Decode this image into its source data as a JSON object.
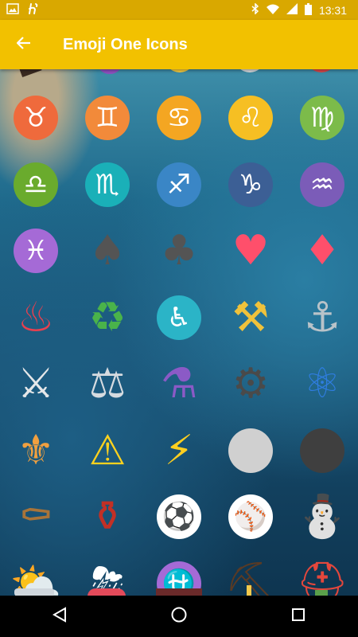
{
  "status_bar": {
    "time": "13:31",
    "left_icons": [
      "image-icon",
      "app-h-icon"
    ],
    "right_icons": [
      "bluetooth-icon",
      "wifi-icon",
      "cellular-icon",
      "battery-icon"
    ],
    "color": "#d9a800"
  },
  "app_bar": {
    "title": "Emoji One Icons",
    "back_icon": "arrow-back-icon",
    "color": "#f2c100"
  },
  "grid": {
    "rows": [
      [
        {
          "name": "taurus-icon",
          "glyph": "♉",
          "bg": "#ef6a3c"
        },
        {
          "name": "gemini-icon",
          "glyph": "♊",
          "bg": "#f28a3a"
        },
        {
          "name": "cancer-icon",
          "glyph": "♋",
          "bg": "#f4a622"
        },
        {
          "name": "leo-icon",
          "glyph": "♌",
          "bg": "#f6bf23"
        },
        {
          "name": "virgo-icon",
          "glyph": "♍",
          "bg": "#7cbb4a"
        }
      ],
      [
        {
          "name": "libra-icon",
          "glyph": "♎",
          "bg": "#6aab2d"
        },
        {
          "name": "scorpio-icon",
          "glyph": "♏",
          "bg": "#1ab0b8"
        },
        {
          "name": "sagittarius-icon",
          "glyph": "♐",
          "bg": "#3a86c6"
        },
        {
          "name": "capricorn-icon",
          "glyph": "♑",
          "bg": "#3c5f95"
        },
        {
          "name": "aquarius-icon",
          "glyph": "♒",
          "bg": "#7b5cb8"
        }
      ],
      [
        {
          "name": "pisces-icon",
          "glyph": "♓",
          "bg": "#a56ad6"
        },
        {
          "name": "spade-suit-icon",
          "glyph": "♠",
          "bg": "none",
          "color": "#545454"
        },
        {
          "name": "club-suit-icon",
          "glyph": "♣",
          "bg": "none",
          "color": "#545454"
        },
        {
          "name": "heart-suit-icon",
          "glyph": "♥",
          "bg": "none",
          "color": "#ff4f6b"
        },
        {
          "name": "diamond-suit-icon",
          "glyph": "♦",
          "bg": "none",
          "color": "#ff4f6b"
        }
      ],
      [
        {
          "name": "hot-springs-icon",
          "glyph": "♨",
          "bg": "none",
          "color": "#e8404f"
        },
        {
          "name": "recycling-icon",
          "glyph": "♻",
          "bg": "none",
          "color": "#4ab34a"
        },
        {
          "name": "wheelchair-icon",
          "glyph": "♿",
          "bg": "#2bb4c7"
        },
        {
          "name": "hammer-pick-icon",
          "glyph": "⚒",
          "bg": "none",
          "color": "#f0c23b"
        },
        {
          "name": "anchor-icon",
          "glyph": "⚓",
          "bg": "none",
          "color": "#b9c3c9"
        }
      ],
      [
        {
          "name": "crossed-swords-icon",
          "glyph": "⚔",
          "bg": "none",
          "color": "#e5e7e9"
        },
        {
          "name": "balance-scale-icon",
          "glyph": "⚖",
          "bg": "none",
          "color": "#d6dbe0"
        },
        {
          "name": "alembic-icon",
          "glyph": "⚗",
          "bg": "none",
          "color": "#8b5ac6"
        },
        {
          "name": "gear-icon",
          "glyph": "⚙",
          "bg": "none",
          "color": "#4a4a4a"
        },
        {
          "name": "atom-icon",
          "glyph": "⚛",
          "bg": "none",
          "color": "#2f7de0"
        }
      ],
      [
        {
          "name": "fleur-de-lis-icon",
          "glyph": "⚜",
          "bg": "none",
          "color": "#f0a040"
        },
        {
          "name": "warning-icon",
          "glyph": "⚠",
          "bg": "none",
          "color": "#ffd21e"
        },
        {
          "name": "high-voltage-icon",
          "glyph": "⚡",
          "bg": "none",
          "color": "#ffcf1f"
        },
        {
          "name": "white-circle-icon",
          "glyph": "",
          "bg": "#d0d0d0"
        },
        {
          "name": "black-circle-icon",
          "glyph": "",
          "bg": "#3f3f3f"
        }
      ],
      [
        {
          "name": "coffin-icon",
          "glyph": "⚰",
          "bg": "none",
          "color": "#a97439"
        },
        {
          "name": "funeral-urn-icon",
          "glyph": "⚱",
          "bg": "none",
          "color": "#c23025"
        },
        {
          "name": "soccer-ball-icon",
          "glyph": "⚽",
          "bg": "#ffffff",
          "color": "#222222"
        },
        {
          "name": "baseball-icon",
          "glyph": "⚾",
          "bg": "#ffffff",
          "color": "#e04040"
        },
        {
          "name": "snowman-icon",
          "glyph": "⛄",
          "bg": "none",
          "color": "#ffffff"
        }
      ],
      [
        {
          "name": "sun-behind-cloud-icon",
          "glyph": "⛅",
          "bg": "none",
          "color": "#ffffff"
        },
        {
          "name": "cloud-lightning-rain-icon",
          "glyph": "⛈",
          "bg": "none",
          "color": "#ffffff"
        },
        {
          "name": "ophiuchus-icon",
          "glyph": "⛎",
          "bg": "#a56ad6"
        },
        {
          "name": "pick-icon",
          "glyph": "⛏",
          "bg": "none",
          "color": "#5a3a24"
        },
        {
          "name": "rescue-helmet-icon",
          "glyph": "⛑",
          "bg": "none",
          "color": "#e4473c"
        }
      ]
    ]
  },
  "nav_bar": {
    "back_icon": "nav-back-icon",
    "home_icon": "nav-home-icon",
    "recents_icon": "nav-recents-icon"
  }
}
